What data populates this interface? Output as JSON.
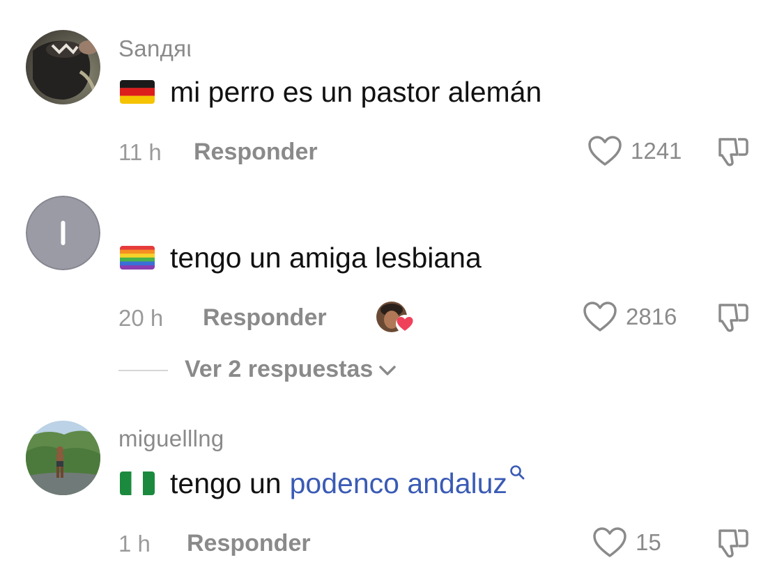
{
  "comments": [
    {
      "username": "Sanдяι",
      "flag_icon": "germany-flag-icon",
      "text": "mi perro es un pastor alemán",
      "time": "11 h",
      "reply_label": "Responder",
      "likes": "1241"
    },
    {
      "username": "",
      "flag_icon": "rainbow-flag-icon",
      "text": "tengo un amiga lesbiana",
      "time": "20 h",
      "reply_label": "Responder",
      "likes": "2816",
      "creator_liked": true,
      "view_replies_label": "Ver 2 respuestas"
    },
    {
      "username": "miguelllng",
      "flag_icon": "nigeria-flag-icon",
      "text": "tengo un",
      "link_text": "podenco andaluz",
      "time": "1 h",
      "reply_label": "Responder",
      "likes": "15"
    }
  ],
  "colors": {
    "text": "#111111",
    "secondary_text": "#8a8a8a",
    "link": "#3a5bb5",
    "heart_badge": "#f0415a",
    "divider": "#d6d6d6"
  }
}
